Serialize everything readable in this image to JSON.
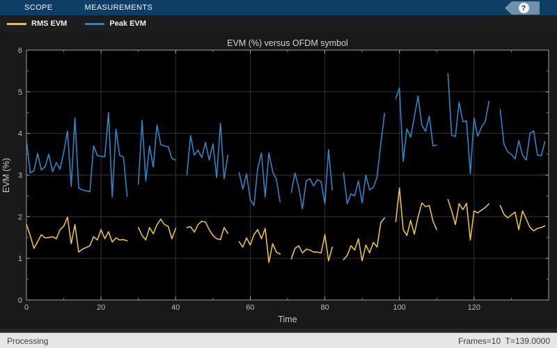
{
  "toolstrip": {
    "tabs": [
      "SCOPE",
      "MEASUREMENTS"
    ],
    "help_label": "?"
  },
  "legend": {
    "items": [
      {
        "label": "RMS EVM",
        "color": "#e9c33c"
      },
      {
        "label": "Peak EVM",
        "color": "#2e86c8"
      }
    ]
  },
  "statusbar": {
    "left": "Processing",
    "right": "Frames=10  T=139.0000"
  },
  "colors": {
    "toolstrip_bg": "#0e3e66",
    "help_tag": "#7390a9",
    "figure_bg": "#191919",
    "plot_bg": "#000000",
    "grid": "#323232",
    "spine": "#a0a0a0",
    "tick_text": "#bebebe",
    "title_text": "#d4d4d4"
  },
  "chart_data": {
    "type": "line",
    "title": "EVM (%) versus OFDM symbol",
    "xlabel": "Time",
    "ylabel": "EVM (%)",
    "xlim": [
      0,
      140
    ],
    "ylim": [
      0,
      6
    ],
    "x_ticks": [
      0,
      20,
      40,
      60,
      80,
      100,
      120
    ],
    "y_ticks": [
      0,
      1,
      2,
      3,
      4,
      5,
      6
    ],
    "x_minor_step": 10,
    "y_minor_step": 0.5,
    "grid": true,
    "legend_position": "top-left-bar",
    "note_gaps": "line breaks (NaN) between frames at t=28-29,41-42,55-56,69-70,83-84,97-98,111-112,125-126",
    "series": [
      {
        "name": "RMS EVM",
        "color": "#e9c33c",
        "values": [
          1.81,
          1.55,
          1.24,
          1.4,
          1.57,
          1.49,
          1.5,
          1.52,
          1.47,
          1.69,
          1.77,
          1.99,
          1.35,
          1.81,
          1.15,
          1.22,
          1.26,
          1.3,
          1.52,
          1.44,
          1.69,
          1.47,
          1.64,
          1.39,
          1.49,
          1.44,
          1.45,
          1.42,
          null,
          null,
          1.74,
          1.55,
          1.44,
          1.74,
          1.59,
          1.81,
          1.94,
          1.81,
          1.77,
          1.47,
          1.72,
          null,
          null,
          1.74,
          1.76,
          1.63,
          1.81,
          1.89,
          1.87,
          1.69,
          1.55,
          1.47,
          1.45,
          1.74,
          1.6,
          null,
          null,
          1.4,
          1.27,
          1.49,
          1.32,
          1.57,
          1.69,
          1.47,
          1.72,
          0.9,
          1.35,
          1.15,
          1.1,
          null,
          null,
          0.99,
          1.24,
          1.3,
          1.13,
          1.22,
          1.2,
          1.15,
          1.15,
          1.13,
          1.57,
          0.94,
          1.27,
          null,
          null,
          0.97,
          1.07,
          1.3,
          1.2,
          1.47,
          0.94,
          1.32,
          1.13,
          1.38,
          1.27,
          1.86,
          1.97,
          null,
          null,
          1.88,
          2.69,
          1.69,
          1.55,
          1.91,
          1.58,
          2.0,
          2.33,
          2.24,
          2.27,
          1.89,
          1.69,
          null,
          null,
          2.41,
          2.14,
          1.81,
          2.31,
          2.17,
          2.32,
          1.44,
          2.14,
          2.09,
          2.16,
          2.22,
          2.31,
          null,
          null,
          2.27,
          2.06,
          1.97,
          2.04,
          2.11,
          1.69,
          2.14,
          1.94,
          1.74,
          1.66,
          1.72,
          1.74,
          1.78
        ]
      },
      {
        "name": "Peak EVM",
        "color": "#2e86c8",
        "values": [
          3.85,
          3.05,
          3.1,
          3.52,
          3.12,
          3.2,
          3.5,
          3.08,
          3.3,
          3.14,
          3.55,
          4.06,
          2.73,
          4.37,
          2.69,
          2.64,
          2.62,
          2.6,
          3.7,
          3.47,
          3.45,
          3.44,
          4.5,
          2.47,
          4.1,
          3.47,
          3.44,
          2.49,
          null,
          null,
          2.78,
          4.31,
          2.86,
          3.7,
          3.19,
          4.2,
          3.73,
          3.7,
          3.68,
          3.4,
          3.36,
          null,
          null,
          3.0,
          3.95,
          3.48,
          3.6,
          3.42,
          3.78,
          3.36,
          3.75,
          2.94,
          4.25,
          2.91,
          3.48,
          null,
          null,
          3.06,
          2.66,
          3.03,
          2.41,
          2.27,
          3.16,
          3.53,
          2.47,
          3.53,
          3.08,
          2.9,
          2.35,
          null,
          null,
          2.58,
          3.05,
          2.7,
          2.19,
          2.86,
          2.91,
          2.74,
          2.89,
          2.84,
          2.31,
          3.61,
          2.64,
          null,
          null,
          3.05,
          2.31,
          2.55,
          2.5,
          2.86,
          2.33,
          3.0,
          2.64,
          2.7,
          2.96,
          3.75,
          4.48,
          null,
          null,
          4.84,
          5.09,
          3.33,
          4.11,
          3.91,
          4.4,
          4.9,
          4.2,
          4.05,
          4.42,
          3.7,
          3.72,
          null,
          null,
          5.44,
          3.95,
          3.93,
          4.75,
          4.28,
          4.3,
          3.03,
          4.37,
          3.93,
          4.15,
          4.28,
          4.77,
          null,
          null,
          4.58,
          3.75,
          3.56,
          3.5,
          3.39,
          3.83,
          3.48,
          3.36,
          4.0,
          4.06,
          3.48,
          3.46,
          3.8
        ]
      }
    ]
  }
}
